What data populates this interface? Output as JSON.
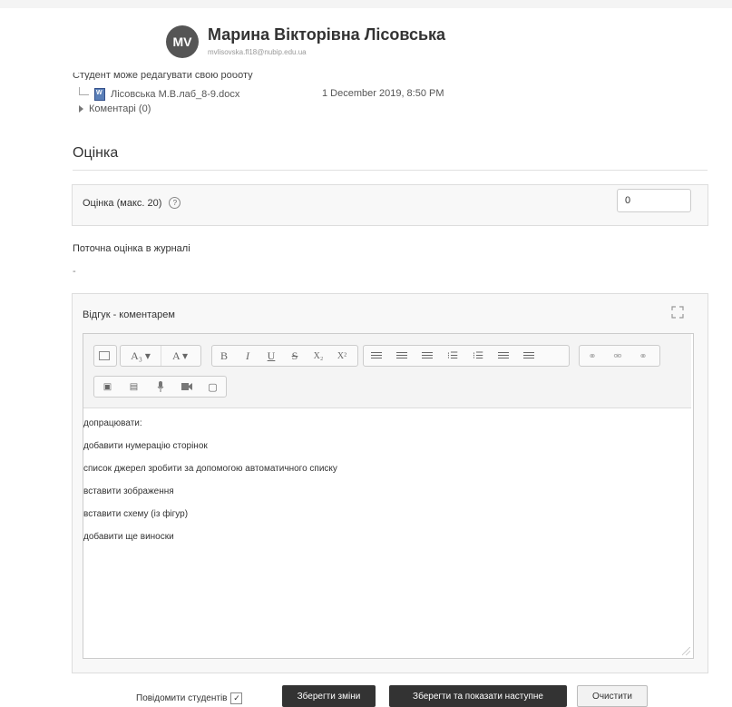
{
  "header": {
    "avatar_initials": "MV",
    "student_name": "Марина Вікторівна Лісовська",
    "student_email": "mvlisovska.fl18@nubip.edu.ua"
  },
  "submission": {
    "status": "Студент може редагувати свою роботу",
    "file_name": "Лісовська М.В.лаб_8-9.docx",
    "file_date": "1 December 2019, 8:50 PM",
    "comments": "Коментарі (0)"
  },
  "grade": {
    "heading": "Оцінка",
    "label": "Оцінка (макс. 20)",
    "value": "0",
    "current_label": "Поточна оцінка в журналі",
    "current_value": "-"
  },
  "feedback": {
    "label": "Відгук - коментарем",
    "toolbar_row1": [
      {
        "name": "paragraph-style-icon",
        "glyph": ""
      },
      {
        "name": "font-size-dropdown",
        "glyph": "A₃ ▾"
      },
      {
        "name": "font-color-dropdown",
        "glyph": "A ▾"
      },
      {
        "name": "bold-button",
        "glyph": "B"
      },
      {
        "name": "italic-button",
        "glyph": "I"
      },
      {
        "name": "underline-button",
        "glyph": "U"
      },
      {
        "name": "strikethrough-button",
        "glyph": "S"
      },
      {
        "name": "subscript-button",
        "glyph": "X₂"
      },
      {
        "name": "superscript-button",
        "glyph": "X²"
      },
      {
        "name": "align-left-button",
        "glyph": ""
      },
      {
        "name": "align-center-button",
        "glyph": ""
      },
      {
        "name": "align-right-button",
        "glyph": ""
      },
      {
        "name": "ordered-list-button",
        "glyph": "⁝☰"
      },
      {
        "name": "unordered-list-button",
        "glyph": "⁝☰"
      },
      {
        "name": "outdent-button",
        "glyph": ""
      },
      {
        "name": "indent-button",
        "glyph": ""
      },
      {
        "name": "link-button",
        "glyph": "⚭"
      },
      {
        "name": "unlink-button",
        "glyph": "⚮"
      },
      {
        "name": "anchor-button",
        "glyph": "⚭"
      }
    ],
    "toolbar_row2": [
      {
        "name": "image-icon",
        "glyph": "▣"
      },
      {
        "name": "media-icon",
        "glyph": "▤"
      },
      {
        "name": "microphone-icon",
        "glyph": "🎙"
      },
      {
        "name": "video-camera-icon",
        "glyph": "■"
      },
      {
        "name": "paste-icon",
        "glyph": "▢"
      }
    ],
    "lines": [
      "допрацювати:",
      "добавити нумерацію сторінок",
      "список джерел зробити за допомогою автоматичного списку",
      "вставити зображення",
      "вставити схему (із фігур)",
      "добавити ще виноски"
    ]
  },
  "footer": {
    "notify_label": "Повідомити студентів",
    "notify_checked": "✓",
    "save": "Зберегти зміни",
    "save_next": "Зберегти та показати наступне",
    "reset": "Очистити"
  }
}
